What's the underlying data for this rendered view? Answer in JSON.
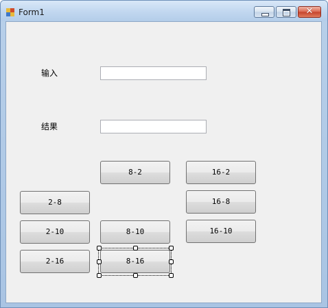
{
  "window": {
    "title": "Form1"
  },
  "form": {
    "input_label": "输入",
    "result_label": "结果",
    "input_value": "",
    "result_value": ""
  },
  "buttons": {
    "b_8_2": "8-2",
    "b_16_2": "16-2",
    "b_2_8": "2-8",
    "b_16_8": "16-8",
    "b_2_10": "2-10",
    "b_8_10": "8-10",
    "b_16_10": "16-10",
    "b_2_16": "2-16",
    "b_8_16": "8-16"
  },
  "colors": {
    "client_bg": "#f0f0f0",
    "close_button": "#c4412a"
  },
  "icons": {
    "app": "winforms-app-icon",
    "minimize": "minimize-icon",
    "maximize": "maximize-icon",
    "close": "close-icon"
  }
}
